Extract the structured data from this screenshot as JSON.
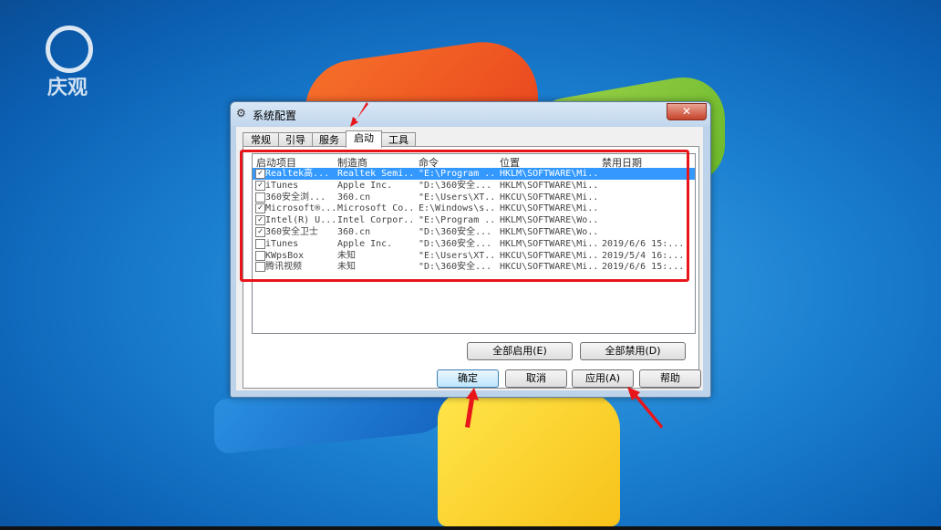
{
  "watermark": {
    "text": "庆观"
  },
  "dialog": {
    "title": "系统配置",
    "close_glyph": "✕",
    "tabs": [
      {
        "label": "常规"
      },
      {
        "label": "引导"
      },
      {
        "label": "服务"
      },
      {
        "label": "启动"
      },
      {
        "label": "工具"
      }
    ],
    "columns": [
      "启动项目",
      "制造商",
      "命令",
      "位置",
      "禁用日期"
    ],
    "rows": [
      {
        "checked": true,
        "name": "Realtek高...",
        "maker": "Realtek Semi...",
        "command": "\"E:\\Program ...",
        "location": "HKLM\\SOFTWARE\\Mi...",
        "date": ""
      },
      {
        "checked": true,
        "name": "iTunes",
        "maker": "Apple Inc.",
        "command": "\"D:\\360安全...",
        "location": "HKLM\\SOFTWARE\\Mi...",
        "date": ""
      },
      {
        "checked": false,
        "name": "360安全浏...",
        "maker": "360.cn",
        "command": "\"E:\\Users\\XT...",
        "location": "HKCU\\SOFTWARE\\Mi...",
        "date": ""
      },
      {
        "checked": true,
        "name": "Microsoft®...",
        "maker": "Microsoft Co...",
        "command": "E:\\Windows\\s...",
        "location": "HKCU\\SOFTWARE\\Mi...",
        "date": ""
      },
      {
        "checked": true,
        "name": "Intel(R) U...",
        "maker": "Intel Corpor...",
        "command": "\"E:\\Program ...",
        "location": "HKLM\\SOFTWARE\\Wo...",
        "date": ""
      },
      {
        "checked": true,
        "name": "360安全卫士",
        "maker": "360.cn",
        "command": "\"D:\\360安全...",
        "location": "HKLM\\SOFTWARE\\Wo...",
        "date": ""
      },
      {
        "checked": false,
        "name": "iTunes",
        "maker": "Apple Inc.",
        "command": "\"D:\\360安全...",
        "location": "HKLM\\SOFTWARE\\Mi...",
        "date": "2019/6/6 15:..."
      },
      {
        "checked": false,
        "name": "KWpsBox",
        "maker": "未知",
        "command": "\"E:\\Users\\XT...",
        "location": "HKCU\\SOFTWARE\\Mi...",
        "date": "2019/5/4 16:..."
      },
      {
        "checked": false,
        "name": "腾讯视频",
        "maker": "未知",
        "command": "\"D:\\360安全...",
        "location": "HKCU\\SOFTWARE\\Mi...",
        "date": "2019/6/6 15:..."
      }
    ],
    "enable_all_label": "全部启用(E)",
    "disable_all_label": "全部禁用(D)",
    "ok_label": "确定",
    "cancel_label": "取消",
    "apply_label": "应用(A)",
    "help_label": "帮助"
  },
  "colors": {
    "highlight": "#e8161b",
    "selection": "#3399ff"
  }
}
